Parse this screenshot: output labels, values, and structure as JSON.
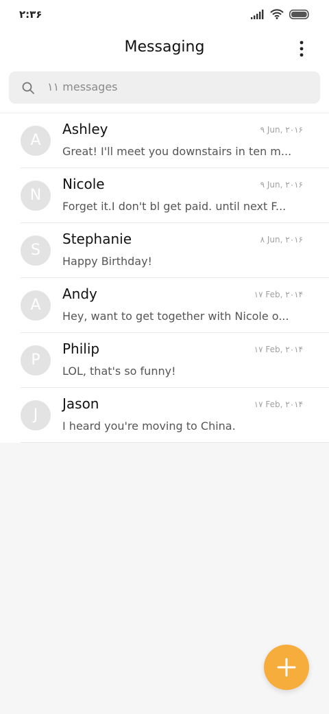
{
  "status_bar": {
    "time": "۲:۳۶",
    "icons": [
      "signal-icon",
      "wifi-icon",
      "battery-icon"
    ]
  },
  "header": {
    "title": "Messaging",
    "more_icon": "more-vertical-icon"
  },
  "search": {
    "placeholder": "۱۱ messages",
    "icon": "search-icon"
  },
  "conversations": [
    {
      "initial": "A",
      "name": "Ashley",
      "date": "۹ Jun, ۲۰۱۶",
      "preview": "Great! I'll meet you downstairs in ten m..."
    },
    {
      "initial": "N",
      "name": "Nicole",
      "date": "۹ Jun, ۲۰۱۶",
      "preview": "Forget it.I don't bl get paid. until next F..."
    },
    {
      "initial": "S",
      "name": "Stephanie",
      "date": "۸ Jun, ۲۰۱۶",
      "preview": "Happy Birthday!"
    },
    {
      "initial": "A",
      "name": "Andy",
      "date": "۱۷ Feb, ۲۰۱۴",
      "preview": "Hey, want to get together with Nicole o..."
    },
    {
      "initial": "P",
      "name": "Philip",
      "date": "۱۷ Feb, ۲۰۱۴",
      "preview": "LOL, that's so funny!"
    },
    {
      "initial": "J",
      "name": "Jason",
      "date": "۱۷ Feb, ۲۰۱۴",
      "preview": "I heard you're moving to China."
    }
  ],
  "fab": {
    "icon": "plus-icon",
    "color": "#f7ad3c"
  },
  "colors": {
    "accent": "#f7ad3c",
    "avatar_bg": "#e3e3e3",
    "background": "#f6f6f6"
  }
}
